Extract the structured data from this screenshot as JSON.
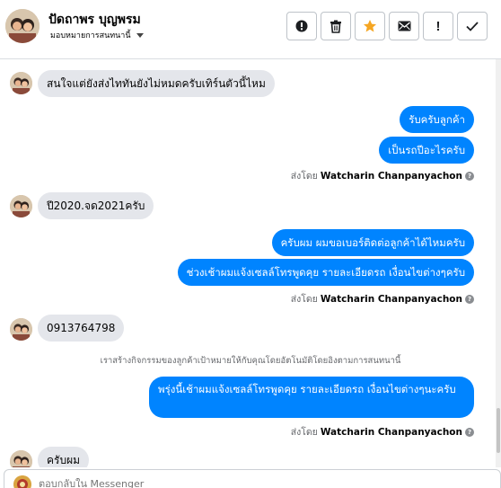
{
  "header": {
    "contact_name": "ปัดถาพร บุญพรม",
    "assignment": "มอบหมายการสนทนานี้",
    "buttons": {
      "report": "report-icon",
      "delete": "trash-icon",
      "star": "star-icon",
      "mail": "envelope-icon",
      "mark_spam": "!",
      "done": "check-icon"
    },
    "colors": {
      "star": "#f5a623",
      "accent": "#0084ff"
    }
  },
  "messages": [
    {
      "side": "in",
      "text": "สนใจแต่ยังส่งไททันยังไม่หมดครับเทิร์นตัวนี้ไหม"
    },
    {
      "side": "out",
      "text": "รับครับลูกค้า"
    },
    {
      "side": "out",
      "text": "เป็นรถปีอะไรครับ"
    },
    {
      "side": "meta",
      "prefix": "ส่งโดย",
      "sender": "Watcharin Chanpanyachon"
    },
    {
      "side": "in",
      "text": "ปี2020.จด2021ครับ"
    },
    {
      "side": "out",
      "text": "ครับผม ผมขอเบอร์ติดต่อลูกค้าได้ไหมครับ"
    },
    {
      "side": "out",
      "text": "ช่วงเช้าผมแจ้งเซลล์โทรพูดคุย รายละเอียดรถ เงื่อนไขต่างๆครับ"
    },
    {
      "side": "meta",
      "prefix": "ส่งโดย",
      "sender": "Watcharin Chanpanyachon"
    },
    {
      "side": "in",
      "text": "0913764798"
    },
    {
      "side": "system",
      "text": "เราสร้างกิจกรรมของลูกค้าเป้าหมายให้กับคุณโดยอัตโนมัติโดยอิงตามการสนทนานี้"
    },
    {
      "side": "out",
      "text": "พรุ่งนี้เช้าผมแจ้งเซลล์โทรพูดคุย รายละเอียดรถ เงื่อนไขต่างๆนะครับ"
    },
    {
      "side": "meta",
      "prefix": "ส่งโดย",
      "sender": "Watcharin Chanpanyachon"
    },
    {
      "side": "in",
      "text": "ครับผม"
    }
  ],
  "composer": {
    "placeholder": "ตอบกลับใน Messenger"
  }
}
